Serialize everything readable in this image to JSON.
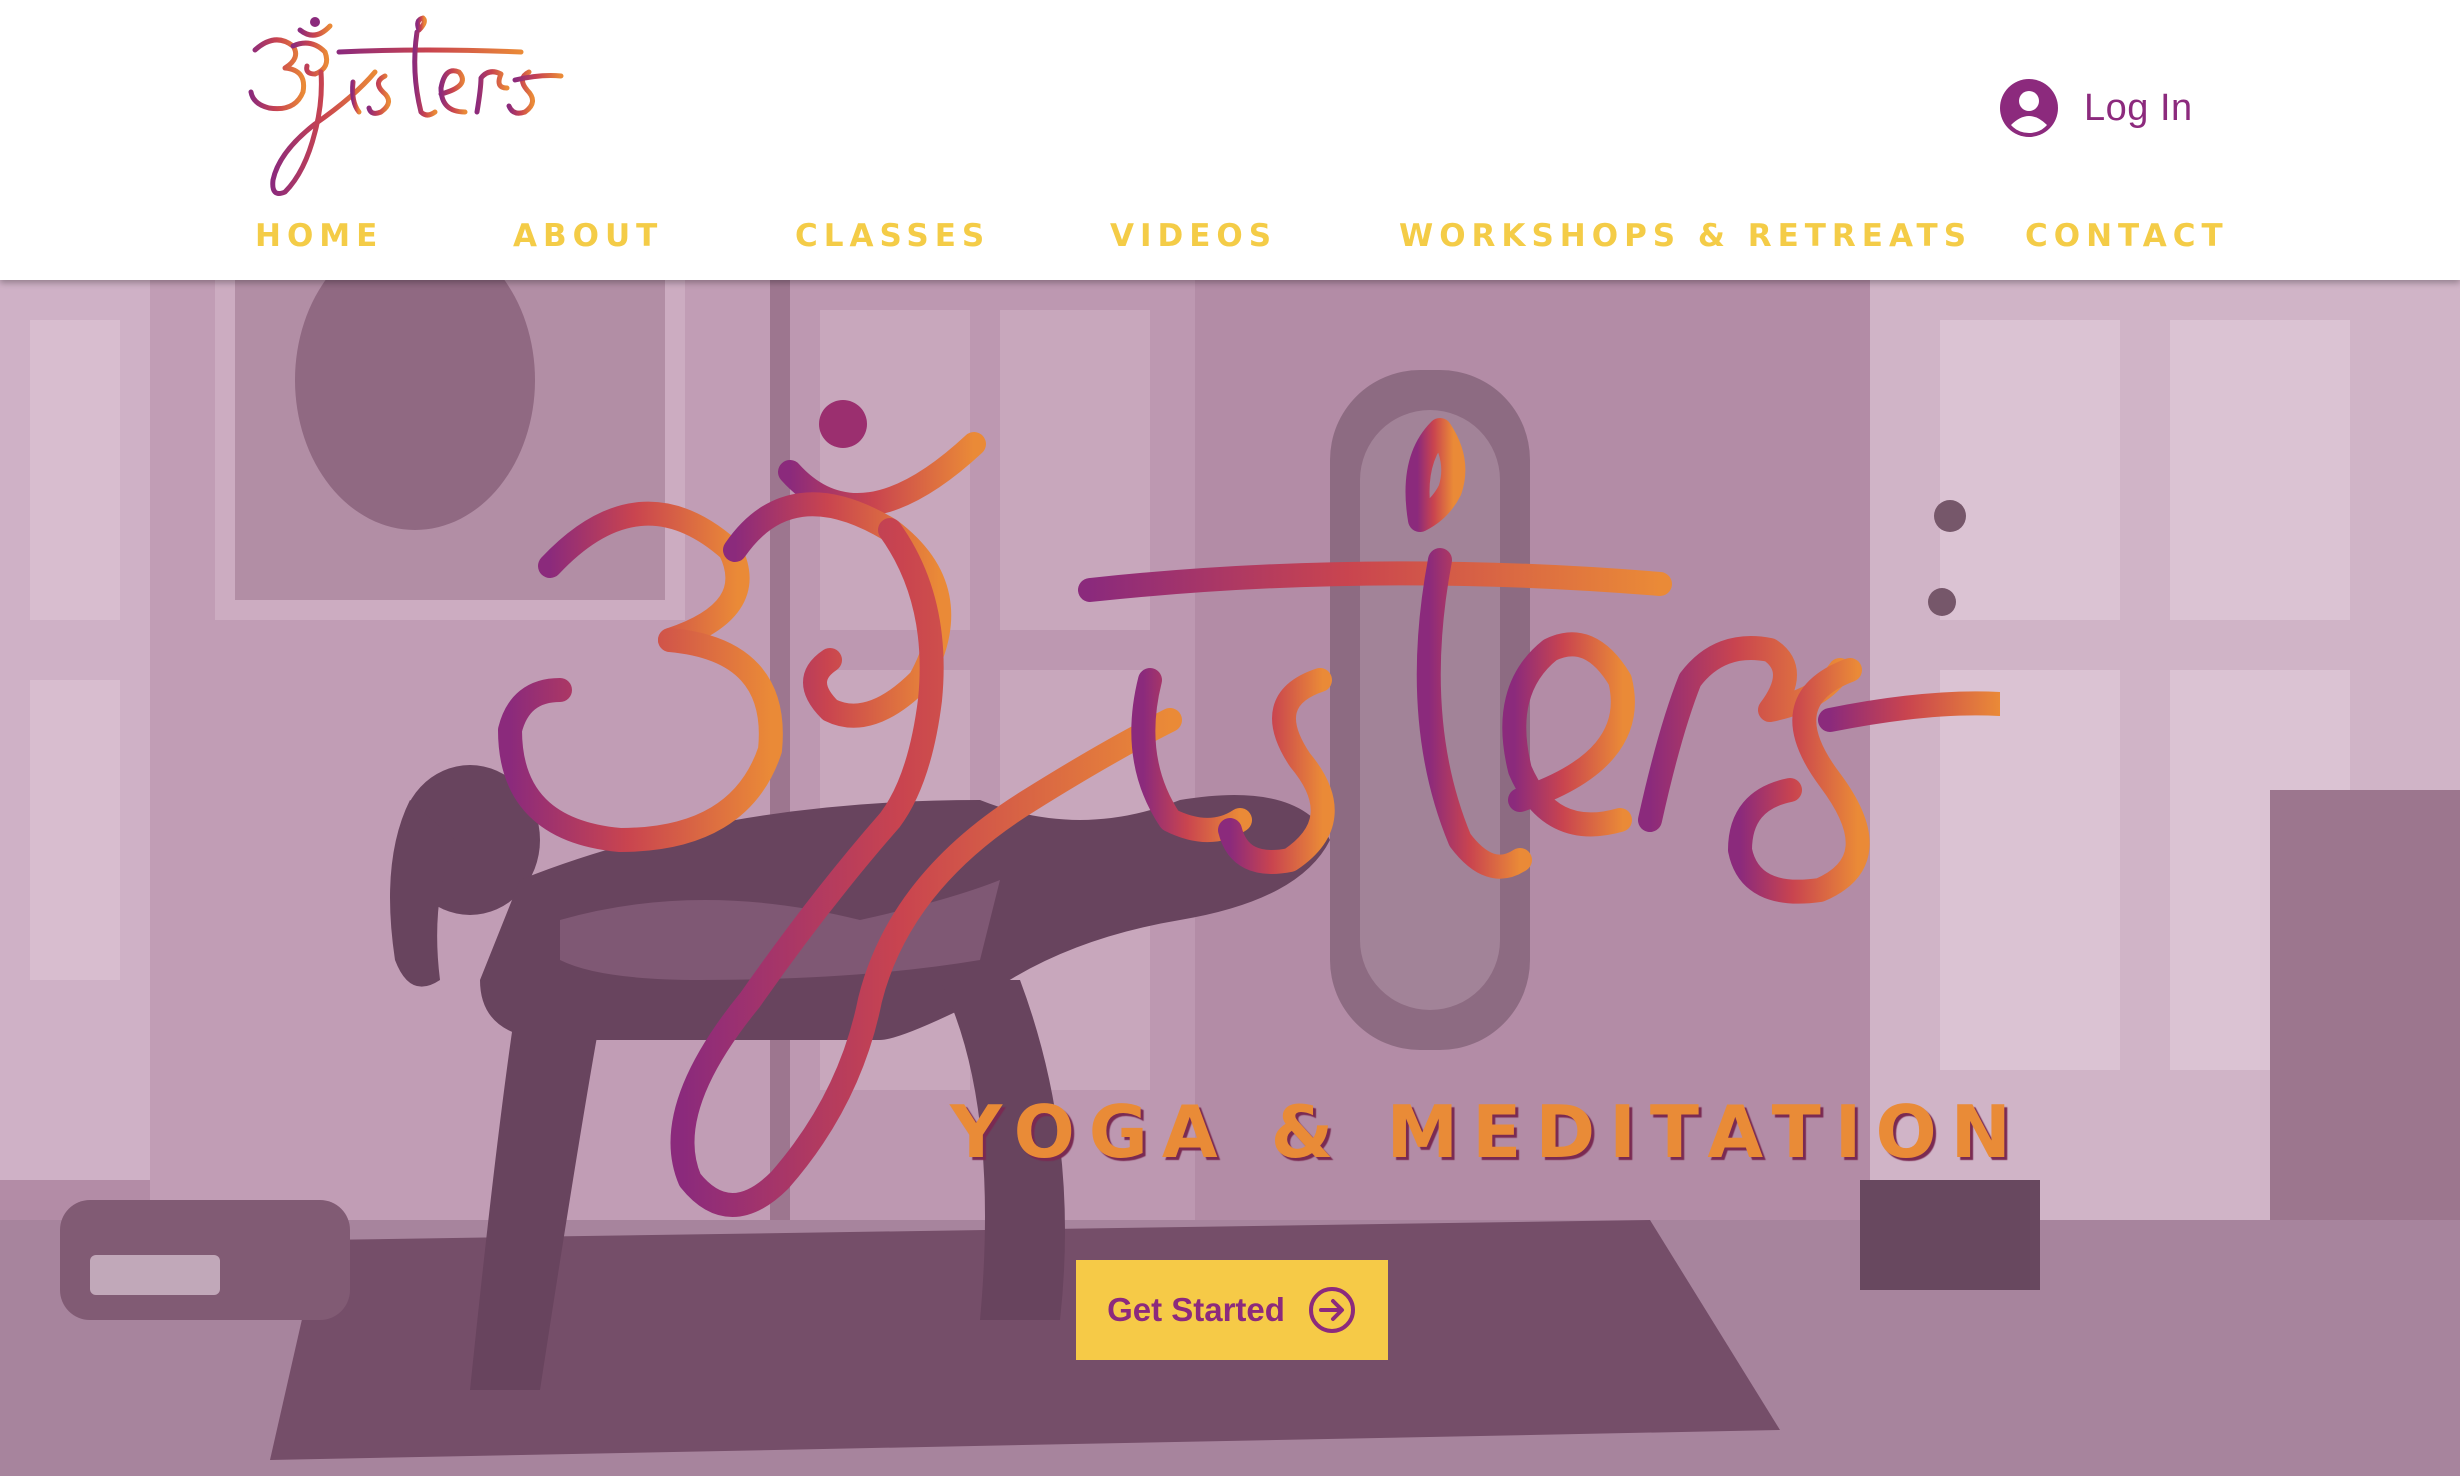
{
  "brand": {
    "logo_name": "OM Sisters",
    "gradient_start": "#8b2a7c",
    "gradient_mid": "#c9444f",
    "gradient_end": "#ea8a37"
  },
  "header": {
    "login": {
      "label": "Log In",
      "icon": "user-avatar-icon"
    },
    "nav": [
      {
        "label": "HOME"
      },
      {
        "label": "ABOUT"
      },
      {
        "label": "CLASSES"
      },
      {
        "label": "VIDEOS"
      },
      {
        "label": "WORKSHOPS & RETREATS"
      },
      {
        "label": "CONTACT"
      }
    ]
  },
  "hero": {
    "tagline": "YOGA & MEDITATION",
    "cta": {
      "label": "Get Started",
      "icon": "arrow-right-circle-icon"
    }
  },
  "colors": {
    "nav_text": "#f4cc47",
    "accent_purple": "#8c2a7d",
    "button_yellow": "#f6ca47",
    "overlay_mauve": "#b892ab"
  }
}
